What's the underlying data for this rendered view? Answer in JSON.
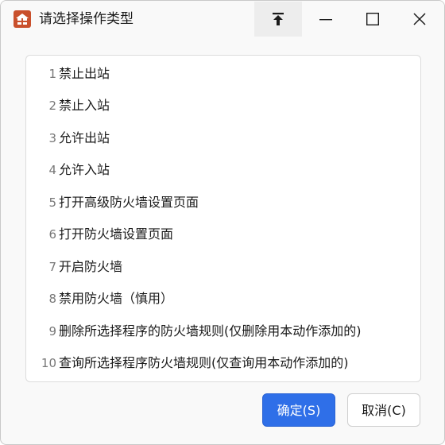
{
  "window": {
    "title": "请选择操作类型",
    "icon": "firewall-app-icon",
    "controls": [
      "pin-top-icon",
      "minimize-icon",
      "maximize-icon",
      "close-icon"
    ]
  },
  "list": {
    "items": [
      {
        "num": "1",
        "label": "禁止出站"
      },
      {
        "num": "2",
        "label": "禁止入站"
      },
      {
        "num": "3",
        "label": "允许出站"
      },
      {
        "num": "4",
        "label": "允许入站"
      },
      {
        "num": "5",
        "label": "打开高级防火墙设置页面"
      },
      {
        "num": "6",
        "label": "打开防火墙设置页面"
      },
      {
        "num": "7",
        "label": "开启防火墙"
      },
      {
        "num": "8",
        "label": "禁用防火墙（慎用）"
      },
      {
        "num": "9",
        "label": "删除所选择程序的防火墙规则(仅删除用本动作添加的)"
      },
      {
        "num": "10",
        "label": "查询所选择程序防火墙规则(仅查询用本动作添加的)"
      }
    ]
  },
  "buttons": {
    "ok_label": "确定(S)",
    "cancel_label": "取消(C)"
  },
  "colors": {
    "accent": "#2f6fe8",
    "icon_brand": "#c9502c"
  }
}
